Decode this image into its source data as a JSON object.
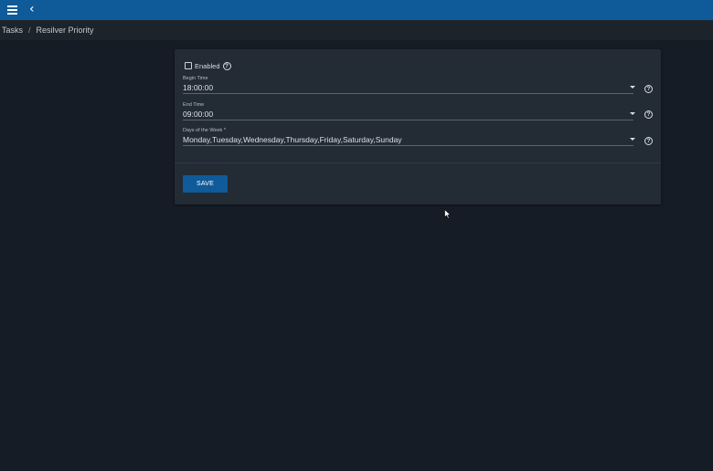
{
  "breadcrumb": {
    "items": [
      "Tasks",
      "Resilver Priority"
    ],
    "separator": "/"
  },
  "form": {
    "enabled_label": "Enabled",
    "enabled_checked": false,
    "begin_time": {
      "label": "Begin Time",
      "value": "18:00:00"
    },
    "end_time": {
      "label": "End Time",
      "value": "09:00:00"
    },
    "days_of_week": {
      "label": "Days of the Week *",
      "value": "Monday,Tuesday,Wednesday,Thursday,Friday,Saturday,Sunday"
    },
    "help_glyph": "?",
    "save_label": "SAVE"
  },
  "colors": {
    "topbar": "#0f5a99",
    "background": "#161c25",
    "card": "#232b35",
    "accent": "#0f5a99"
  },
  "icons": {
    "menu": "hamburger-menu-icon",
    "back": "chevron-left-icon",
    "help": "help-circle-icon",
    "dropdown": "caret-down-icon"
  }
}
